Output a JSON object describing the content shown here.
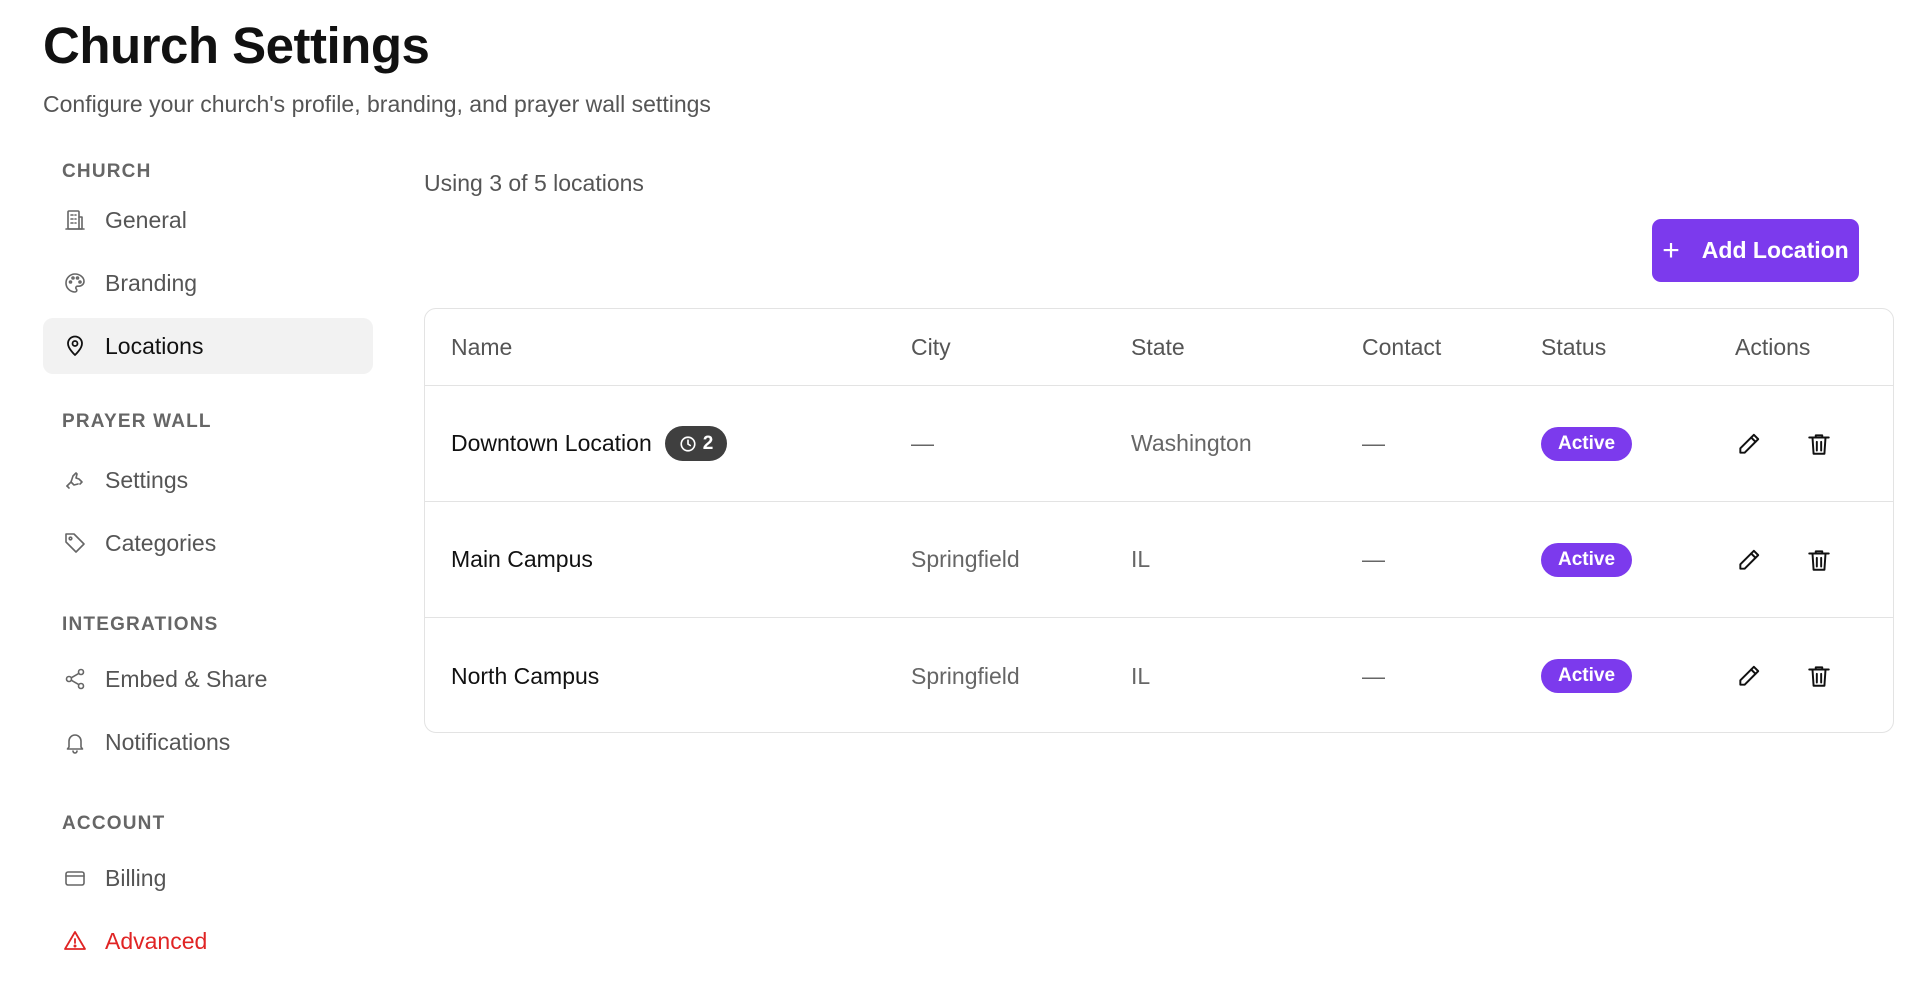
{
  "header": {
    "title": "Church Settings",
    "subtitle": "Configure your church's profile, branding, and prayer wall settings"
  },
  "sidebar": {
    "sections": [
      {
        "title": "CHURCH",
        "items": [
          {
            "label": "General",
            "icon": "building-icon"
          },
          {
            "label": "Branding",
            "icon": "palette-icon"
          },
          {
            "label": "Locations",
            "icon": "map-pin-icon",
            "active": true
          }
        ]
      },
      {
        "title": "PRAYER WALL",
        "items": [
          {
            "label": "Settings",
            "icon": "praying-hands-icon"
          },
          {
            "label": "Categories",
            "icon": "tag-icon"
          }
        ]
      },
      {
        "title": "INTEGRATIONS",
        "items": [
          {
            "label": "Embed & Share",
            "icon": "share-icon"
          },
          {
            "label": "Notifications",
            "icon": "bell-icon"
          }
        ]
      },
      {
        "title": "ACCOUNT",
        "items": [
          {
            "label": "Billing",
            "icon": "credit-card-icon"
          },
          {
            "label": "Advanced",
            "icon": "warning-triangle-icon",
            "danger": true
          }
        ]
      }
    ]
  },
  "main": {
    "usage_text": "Using 3 of 5 locations",
    "add_button_label": "Add Location",
    "table": {
      "headers": {
        "name": "Name",
        "city": "City",
        "state": "State",
        "contact": "Contact",
        "status": "Status",
        "actions": "Actions"
      },
      "rows": [
        {
          "name": "Downtown Location",
          "pending_count": "2",
          "city": "—",
          "state": "Washington",
          "contact": "—",
          "status": "Active"
        },
        {
          "name": "Main Campus",
          "city": "Springfield",
          "state": "IL",
          "contact": "—",
          "status": "Active"
        },
        {
          "name": "North Campus",
          "city": "Springfield",
          "state": "IL",
          "contact": "—",
          "status": "Active"
        }
      ]
    }
  },
  "colors": {
    "accent": "#7c3aed",
    "danger": "#e02424",
    "count_pill": "#3f3f3f"
  }
}
